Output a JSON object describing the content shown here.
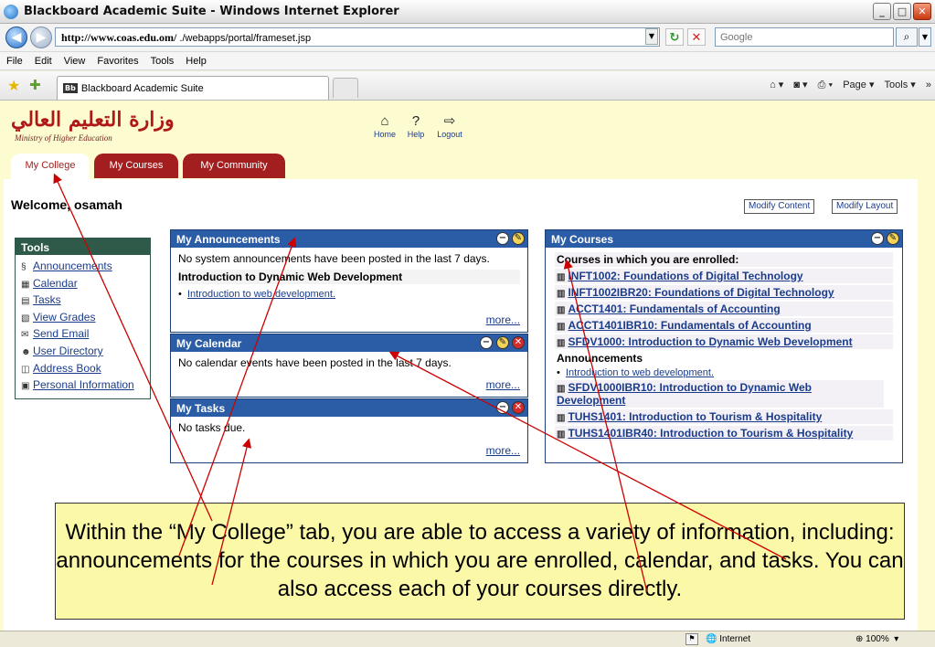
{
  "window": {
    "title": "Blackboard Academic Suite - Windows Internet Explorer",
    "min": "_",
    "max": "□",
    "close": "✕"
  },
  "address": {
    "url_host": "http://www.coas.edu.om/",
    "url_path": " ./webapps/portal/frameset.jsp",
    "search_placeholder": "Google"
  },
  "menu": [
    "File",
    "Edit",
    "View",
    "Favorites",
    "Tools",
    "Help"
  ],
  "tab": {
    "label": "Blackboard Academic Suite",
    "badge": "Bb"
  },
  "ie_tools": {
    "page": "Page ▾",
    "tools": "Tools ▾",
    "more": "»"
  },
  "logo": {
    "arabic": "وزارة التعليم العالي",
    "sub": "Ministry of Higher Education"
  },
  "topnav": {
    "home": "Home",
    "help": "Help",
    "logout": "Logout"
  },
  "college_tabs": [
    "My College",
    "My Courses",
    "My Community"
  ],
  "welcome": "Welcome, osamah",
  "buttons": {
    "modify_content": "Modify Content",
    "modify_layout": "Modify Layout"
  },
  "tools": {
    "title": "Tools",
    "items": [
      {
        "icon": "§",
        "label": "Announcements"
      },
      {
        "icon": "▦",
        "label": "Calendar"
      },
      {
        "icon": "▤",
        "label": "Tasks"
      },
      {
        "icon": "▧",
        "label": "View Grades"
      },
      {
        "icon": "✉",
        "label": "Send Email"
      },
      {
        "icon": "☻",
        "label": "User Directory"
      },
      {
        "icon": "◫",
        "label": "Address Book"
      },
      {
        "icon": "▣",
        "label": "Personal Information"
      }
    ]
  },
  "announcements": {
    "title": "My Announcements",
    "notice": "No system announcements have been posted in the last 7 days.",
    "course": "Introduction to Dynamic Web Development",
    "link": "Introduction to web development.",
    "more": "more..."
  },
  "calendar": {
    "title": "My Calendar",
    "notice": "No calendar events have been posted in the last 7 days.",
    "more": "more..."
  },
  "tasks": {
    "title": "My Tasks",
    "notice": "No tasks due.",
    "more": "more..."
  },
  "courses": {
    "title": "My Courses",
    "heading": "Courses in which you are enrolled:",
    "list_a": [
      "INFT1002: Foundations of Digital Technology",
      "INFT1002IBR20: Foundations of Digital Technology",
      "ACCT1401: Fundamentals of Accounting",
      "ACCT1401IBR10: Fundamentals of Accounting",
      "SFDV1000: Introduction to Dynamic Web Development"
    ],
    "ann_heading": "Announcements",
    "ann_link": "Introduction to web development.",
    "list_b": [
      "SFDV1000IBR10: Introduction to Dynamic Web Development",
      "TUHS1401: Introduction to Tourism & Hospitality",
      "TUHS1401IBR40: Introduction to Tourism & Hospitality"
    ]
  },
  "callout": "Within the “My College” tab, you are able to access a variety of information, including: announcements for the courses in which you are enrolled, calendar, and tasks.  You can also access each of your courses directly.",
  "status": {
    "zone": "Internet",
    "zoom": "100%"
  }
}
